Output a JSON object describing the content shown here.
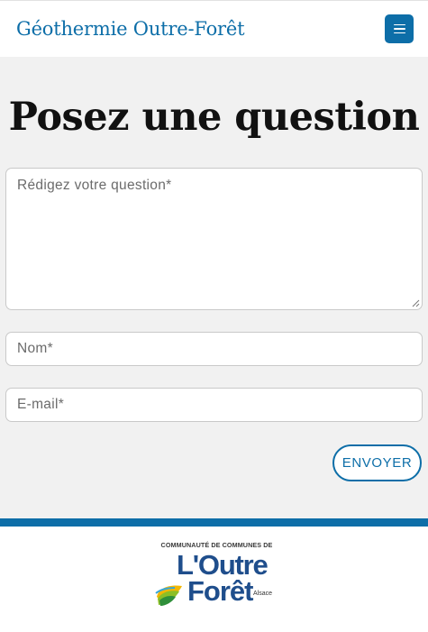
{
  "header": {
    "brand": "Géothermie Outre-Forêt",
    "menu_icon": "hamburger-menu-icon"
  },
  "main": {
    "title": "Posez une question",
    "form": {
      "question_placeholder": "Rédigez votre question*",
      "name_placeholder": "Nom*",
      "email_placeholder": "E-mail*",
      "submit_label": "ENVOYER"
    }
  },
  "footer": {
    "logo": {
      "community": "Communauté de communes de",
      "line1": "L'Outre",
      "line2": "Forêt",
      "region": "Alsace"
    }
  },
  "colors": {
    "brand_blue": "#0d6ea8",
    "logo_blue": "#1f4e8c",
    "background": "#f1f1f1"
  }
}
